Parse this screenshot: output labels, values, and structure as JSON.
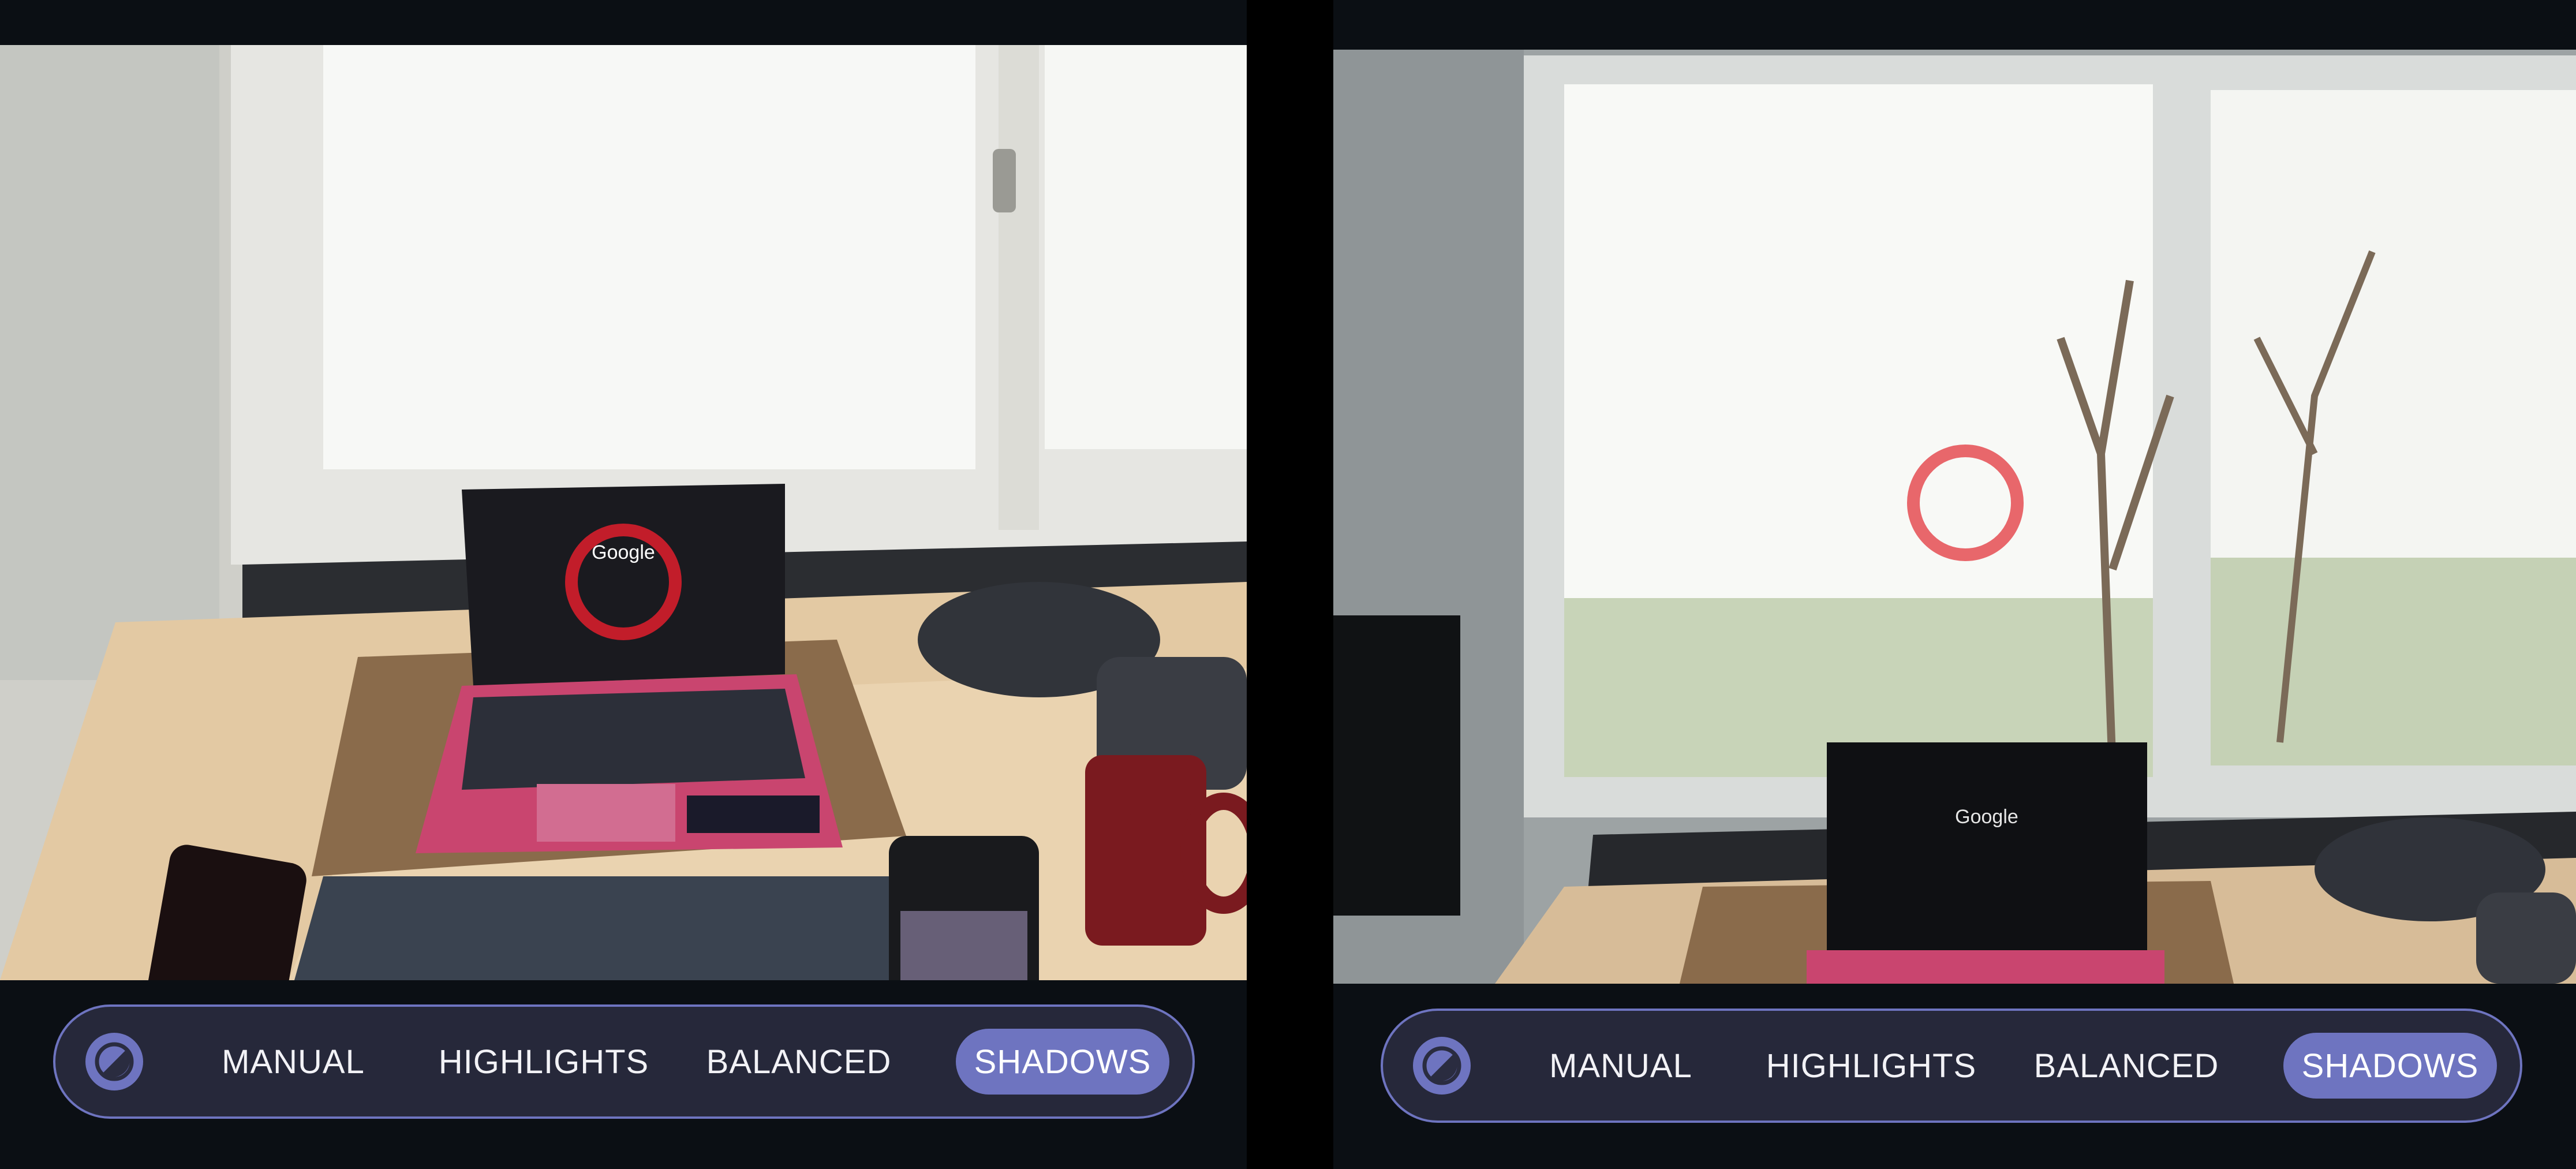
{
  "panels": [
    {
      "id": "left",
      "exposure_modes": [
        "MANUAL",
        "HIGHLIGHTS",
        "BALANCED",
        "SHADOWS"
      ],
      "selected_mode": "SHADOWS",
      "laptop_screen_text": "Google"
    },
    {
      "id": "right",
      "exposure_modes": [
        "MANUAL",
        "HIGHLIGHTS",
        "BALANCED",
        "SHADOWS"
      ],
      "selected_mode": "SHADOWS",
      "laptop_screen_text": "Google"
    }
  ],
  "colors": {
    "accent": "#6e74c0",
    "bar_background": "#26283a",
    "focus_ring": "#e8676b",
    "laptop_pink": "#c9456f"
  },
  "icons": {
    "exposure": "exposure-icon",
    "focus": "focus-ring-icon"
  }
}
